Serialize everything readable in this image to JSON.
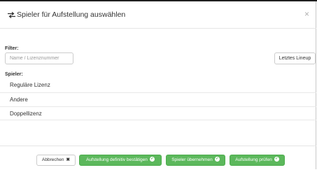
{
  "modal": {
    "title": "Spieler für Aufstellung auswählen",
    "close_symbol": "×",
    "header_icon": "transfer-arrows-icon"
  },
  "filter": {
    "label": "Filter:",
    "placeholder": "Name / Lizenznummer",
    "value": ""
  },
  "lineup_button": "Letztes Lineup",
  "players": {
    "label": "Spieler:",
    "items": [
      "Reguläre Lizenz",
      "Andere",
      "Doppellizenz"
    ]
  },
  "footer": {
    "cancel": "Abbrechen",
    "cancel_icon": "times-icon",
    "confirm": "Aufstellung definitiv bestätigen",
    "take_over": "Spieler übernehmen",
    "check": "Aufstellung prüfen",
    "success_icon": "check-circle-icon"
  },
  "colors": {
    "success": "#5cb85c",
    "border": "#cccccc"
  }
}
